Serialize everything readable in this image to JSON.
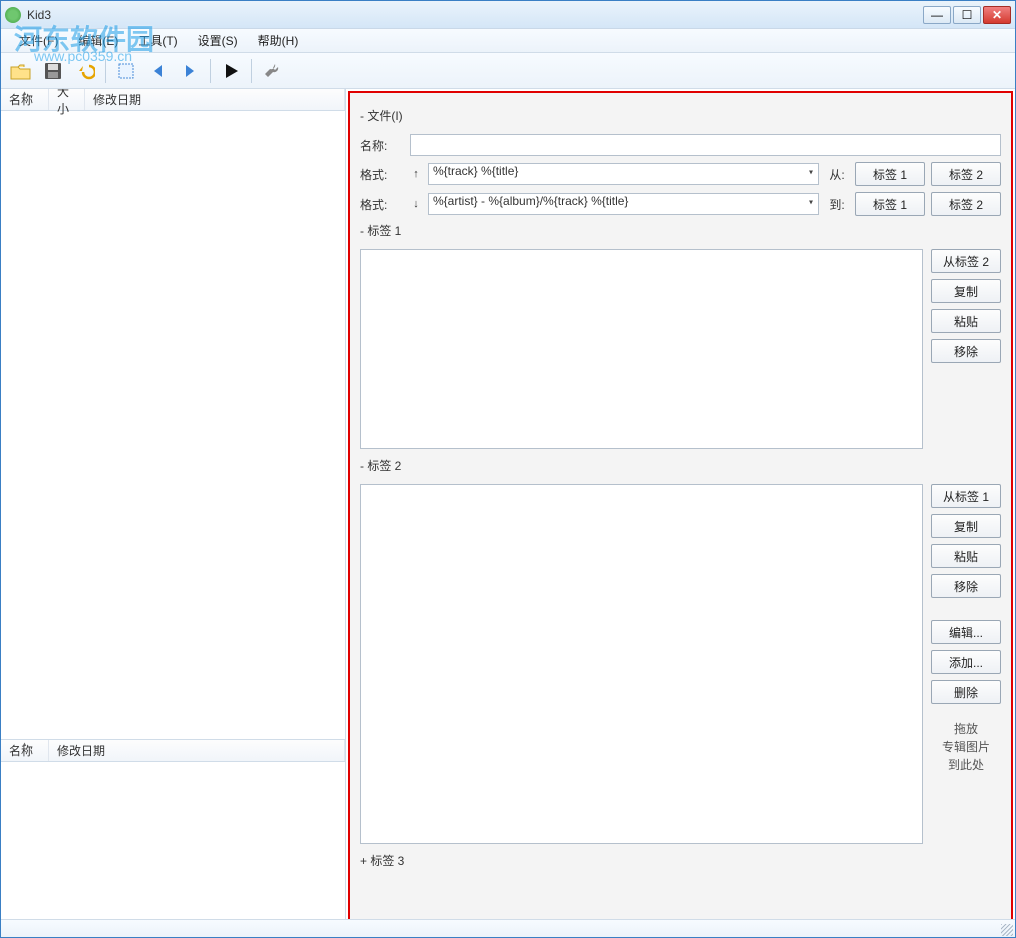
{
  "window": {
    "title": "Kid3"
  },
  "menu": {
    "file": "文件(F)",
    "edit": "编辑(E)",
    "tools": "工具(T)",
    "settings": "设置(S)",
    "help": "帮助(H)"
  },
  "left_tree_cols": {
    "name": "名称",
    "size": "大小",
    "date": "修改日期"
  },
  "left_bottom_cols": {
    "name": "名称",
    "date": "修改日期"
  },
  "file_section": {
    "header": "- 文件(I)",
    "name_label": "名称:",
    "format_label": "格式:",
    "format_up": "%{track} %{title}",
    "format_down": "%{artist} - %{album}/%{track} %{title}",
    "from_label": "从:",
    "to_label": "到:",
    "tag1_btn": "标签 1",
    "tag2_btn": "标签 2"
  },
  "tag1": {
    "header": "- 标签 1",
    "from_tag2": "从标签 2",
    "copy": "复制",
    "paste": "粘贴",
    "remove": "移除"
  },
  "tag2": {
    "header": "- 标签 2",
    "from_tag1": "从标签 1",
    "copy": "复制",
    "paste": "粘贴",
    "remove": "移除",
    "edit": "编辑...",
    "add": "添加...",
    "delete": "删除",
    "drop_hint_l1": "拖放",
    "drop_hint_l2": "专辑图片",
    "drop_hint_l3": "到此处"
  },
  "tag3": {
    "header": "+ 标签 3"
  },
  "watermark": {
    "text": "河东软件园",
    "url": "www.pc0359.cn"
  },
  "win_controls": {
    "min": "—",
    "max": "☐",
    "close": "✕"
  }
}
